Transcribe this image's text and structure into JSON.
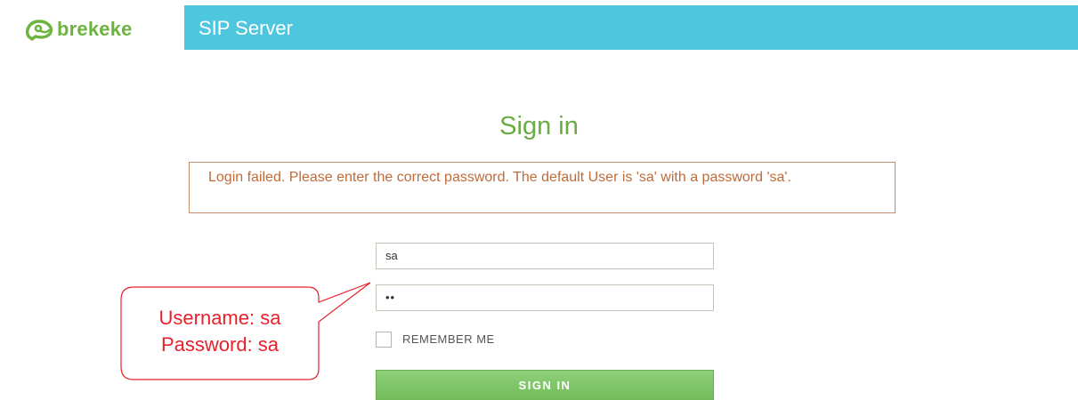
{
  "header": {
    "logo_text": "brekeke",
    "app_title": "SIP Server",
    "logo_icon": "frog-icon",
    "brand_green": "#6cb33f",
    "title_bar_color": "#4ec7de"
  },
  "signin": {
    "heading": "Sign in",
    "error_message": "Login failed. Please enter the correct password. The default User is 'sa' with a password 'sa'.",
    "username_value": "sa",
    "password_value": "••",
    "remember_label": "REMEMBER ME",
    "remember_checked": false,
    "button_label": "SIGN IN"
  },
  "callout": {
    "line1": "Username: sa",
    "line2": "Password: sa",
    "color": "#e8202a"
  }
}
